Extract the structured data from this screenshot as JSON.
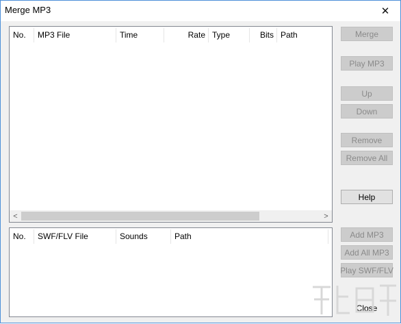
{
  "window": {
    "title": "Merge MP3",
    "close_glyph": "✕"
  },
  "mp3_list": {
    "columns": [
      "No.",
      "MP3 File",
      "Time",
      "Rate",
      "Type",
      "Bits",
      "Path"
    ],
    "rows": [],
    "scroll_left_glyph": "<",
    "scroll_right_glyph": ">"
  },
  "swf_list": {
    "columns": [
      "No.",
      "SWF/FLV File",
      "Sounds",
      "Path"
    ],
    "rows": []
  },
  "buttons": {
    "merge": "Merge",
    "play_mp3": "Play MP3",
    "up": "Up",
    "down": "Down",
    "remove": "Remove",
    "remove_all": "Remove All",
    "help": "Help",
    "add_mp3": "Add MP3",
    "add_all_mp3": "Add All MP3",
    "play_swf_flv": "Play SWF/FLV",
    "close": "Close"
  },
  "colors": {
    "window_bg": "#f0f0f0",
    "border_accent": "#4c8fd9",
    "disabled_button": "#cccccc"
  }
}
